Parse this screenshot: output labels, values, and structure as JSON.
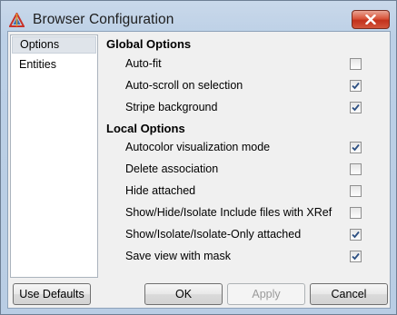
{
  "window": {
    "title": "Browser Configuration"
  },
  "nav": {
    "items": [
      "Options",
      "Entities"
    ]
  },
  "global": {
    "title": "Global Options",
    "options": [
      {
        "label": "Auto-fit",
        "checked": false
      },
      {
        "label": "Auto-scroll on selection",
        "checked": true
      },
      {
        "label": "Stripe background",
        "checked": true
      }
    ]
  },
  "local": {
    "title": "Local Options",
    "options": [
      {
        "label": "Autocolor visualization mode",
        "checked": true
      },
      {
        "label": "Delete association",
        "checked": false
      },
      {
        "label": "Hide attached",
        "checked": false
      },
      {
        "label": "Show/Hide/Isolate Include files with XRef",
        "checked": false
      },
      {
        "label": "Show/Isolate/Isolate-Only attached",
        "checked": true
      },
      {
        "label": "Save view with mask",
        "checked": true
      }
    ]
  },
  "buttons": {
    "use_defaults": "Use Defaults",
    "ok": "OK",
    "apply": "Apply",
    "cancel": "Cancel"
  },
  "colors": {
    "title_bar": "#bcd0e6",
    "close_button": "#c2321c",
    "selection": "#dfe4ea"
  }
}
